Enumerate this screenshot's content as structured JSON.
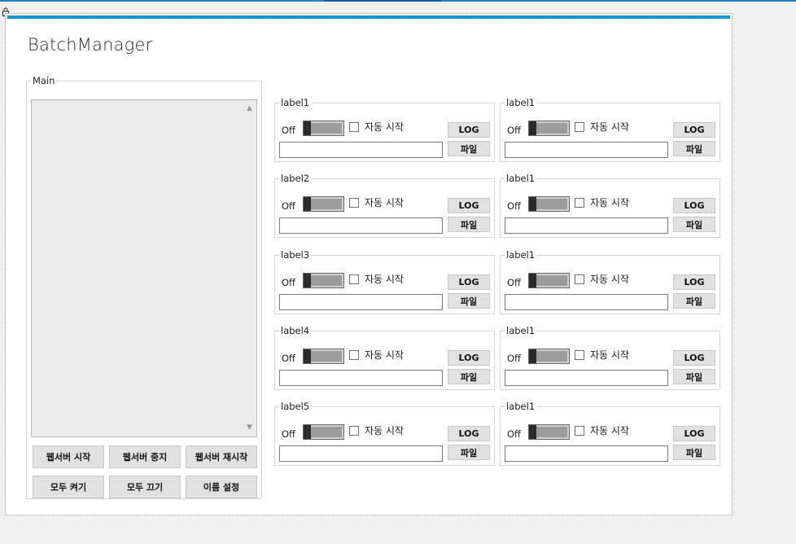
{
  "app": {
    "title": "BatchManager"
  },
  "main": {
    "legend": "Main",
    "buttons": {
      "web_start": "웹서버 시작",
      "web_stop": "웹서버 중지",
      "web_restart": "웹서버 재시작",
      "all_on": "모두 켜기",
      "all_off": "모두 끄기",
      "set_name": "이름 설정"
    }
  },
  "batches": [
    {
      "label": "label1",
      "toggle_text": "Off",
      "toggle_on": false,
      "autostart_label": "자동 시작",
      "autostart_checked": false,
      "log_label": "LOG",
      "file_label": "파일",
      "path": ""
    },
    {
      "label": "label2",
      "toggle_text": "Off",
      "toggle_on": false,
      "autostart_label": "자동 시작",
      "autostart_checked": false,
      "log_label": "LOG",
      "file_label": "파일",
      "path": ""
    },
    {
      "label": "label3",
      "toggle_text": "Off",
      "toggle_on": false,
      "autostart_label": "자동 시작",
      "autostart_checked": false,
      "log_label": "LOG",
      "file_label": "파일",
      "path": ""
    },
    {
      "label": "label4",
      "toggle_text": "Off",
      "toggle_on": false,
      "autostart_label": "자동 시작",
      "autostart_checked": false,
      "log_label": "LOG",
      "file_label": "파일",
      "path": ""
    },
    {
      "label": "label5",
      "toggle_text": "Off",
      "toggle_on": false,
      "autostart_label": "자동 시작",
      "autostart_checked": false,
      "log_label": "LOG",
      "file_label": "파일",
      "path": ""
    },
    {
      "label": "label1",
      "toggle_text": "Off",
      "toggle_on": false,
      "autostart_label": "자동 시작",
      "autostart_checked": false,
      "log_label": "LOG",
      "file_label": "파일",
      "path": ""
    },
    {
      "label": "label1",
      "toggle_text": "Off",
      "toggle_on": false,
      "autostart_label": "자동 시작",
      "autostart_checked": false,
      "log_label": "LOG",
      "file_label": "파일",
      "path": ""
    },
    {
      "label": "label1",
      "toggle_text": "Off",
      "toggle_on": false,
      "autostart_label": "자동 시작",
      "autostart_checked": false,
      "log_label": "LOG",
      "file_label": "파일",
      "path": ""
    },
    {
      "label": "label1",
      "toggle_text": "Off",
      "toggle_on": false,
      "autostart_label": "자동 시작",
      "autostart_checked": false,
      "log_label": "LOG",
      "file_label": "파일",
      "path": ""
    },
    {
      "label": "label1",
      "toggle_text": "Off",
      "toggle_on": false,
      "autostart_label": "자동 시작",
      "autostart_checked": false,
      "log_label": "LOG",
      "file_label": "파일",
      "path": ""
    }
  ],
  "icons": {
    "lock": "lock-icon",
    "scroll_up": "chevron-up-icon",
    "scroll_down": "chevron-down-icon"
  },
  "colors": {
    "accent": "#0a95d6",
    "toggle_knob": "#2b2b2b",
    "toggle_track": "#9b9b9b"
  }
}
